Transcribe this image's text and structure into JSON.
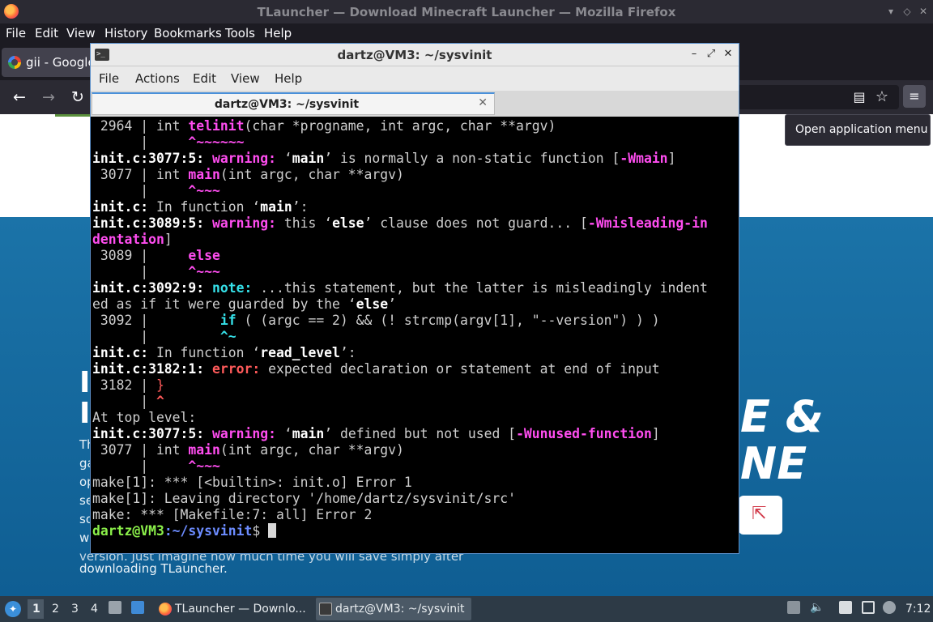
{
  "firefox": {
    "title": "TLauncher — Download Minecraft Launcher — Mozilla Firefox",
    "menu": [
      "File",
      "Edit",
      "View",
      "History",
      "Bookmarks",
      "Tools",
      "Help"
    ],
    "tab_label": "gii - Google",
    "tooltip": "Open application menu",
    "nav": {
      "back": "←",
      "forward": "→",
      "reload": "↻",
      "reader": "▤",
      "bookmark": "☆",
      "menu": "≡"
    }
  },
  "page": {
    "hero_line1": "E &",
    "hero_line2": "NE",
    "left_lines": [
      "Th",
      "ga",
      "op",
      "se",
      "so",
      "w",
      "version. Just imagine how much time you will save simply after",
      "downloading TLauncher."
    ],
    "big_letters": [
      "I",
      "I"
    ]
  },
  "terminal": {
    "title": "dartz@VM3: ~/sysvinit",
    "menu": [
      "File",
      "Actions",
      "Edit",
      "View",
      "Help"
    ],
    "tab_title": "dartz@VM3: ~/sysvinit",
    "prompt_user": "dartz@VM3",
    "prompt_path": ":~/sysvinit",
    "prompt_sign": "$ "
  },
  "taskbar": {
    "workspaces": [
      "1",
      "2",
      "3",
      "4"
    ],
    "items": [
      {
        "label": "TLauncher — Downlo..."
      },
      {
        "label": "dartz@VM3: ~/sysvinit"
      }
    ],
    "clock": "7:12"
  },
  "colors": {
    "warning": "#ff4df0",
    "error": "#ff5a5a",
    "note": "#35e0e8",
    "prompt_user": "#8bf04a",
    "prompt_path": "#6c8cff",
    "taskbar": "#2d3a46"
  }
}
